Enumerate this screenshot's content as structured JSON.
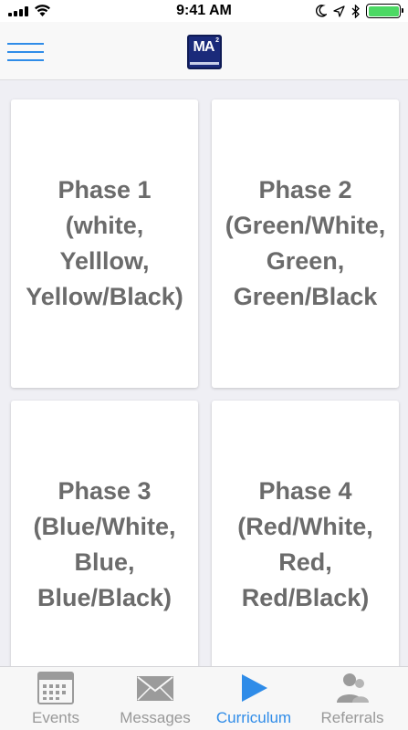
{
  "status_bar": {
    "time": "9:41 AM",
    "icons": [
      "signal-icon",
      "wifi-icon",
      "moon-icon",
      "location-icon",
      "bluetooth-icon",
      "battery-icon"
    ],
    "battery_level": 1.0,
    "battery_color": "#4cd964"
  },
  "nav": {
    "menu_icon": "hamburger-menu-icon",
    "logo_text": "MA",
    "logo_superscript": "2",
    "accent_color": "#2f8ce8",
    "logo_color": "#1a2a7a"
  },
  "phases": [
    {
      "label": "Phase 1\n(white,\nYelllow,\nYellow/Black)"
    },
    {
      "label": "Phase 2\n(Green/White,\nGreen,\nGreen/Black"
    },
    {
      "label": "Phase 3\n(Blue/White,\nBlue,\nBlue/Black)"
    },
    {
      "label": "Phase 4\n(Red/White,\nRed,\nRed/Black)"
    }
  ],
  "tabs": [
    {
      "label": "Events",
      "icon": "calendar-icon",
      "active": false
    },
    {
      "label": "Messages",
      "icon": "envelope-icon",
      "active": false
    },
    {
      "label": "Curriculum",
      "icon": "play-icon",
      "active": true
    },
    {
      "label": "Referrals",
      "icon": "people-icon",
      "active": false
    }
  ]
}
